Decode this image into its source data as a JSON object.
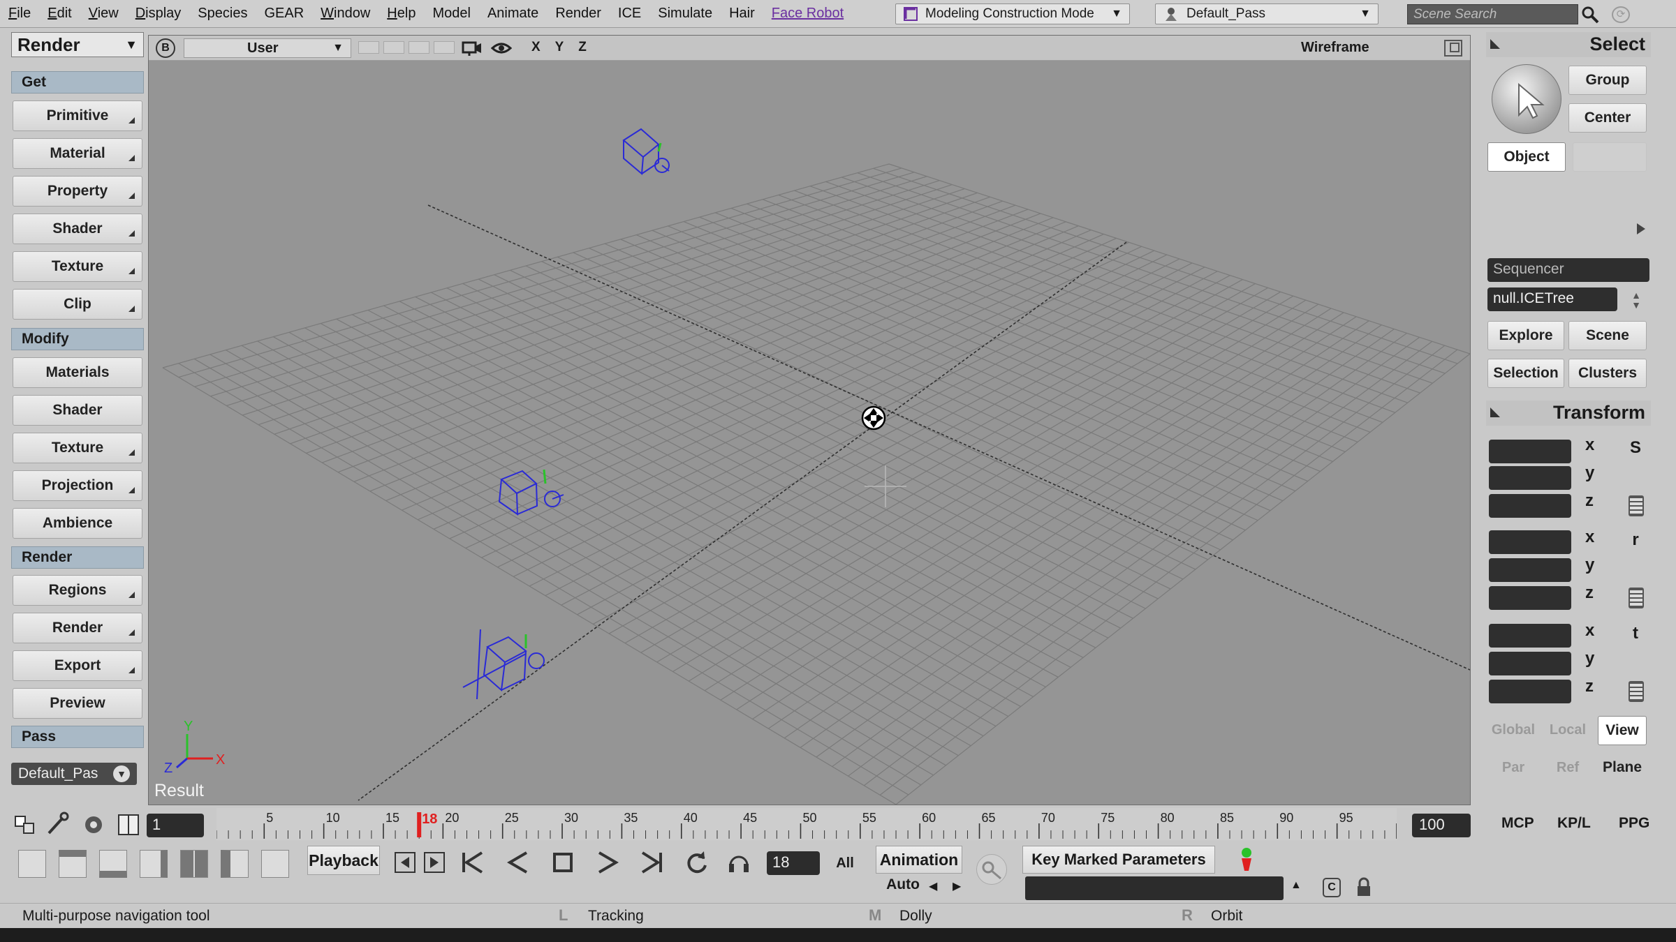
{
  "menubar": {
    "items": [
      "File",
      "Edit",
      "View",
      "Display",
      "Species",
      "GEAR",
      "Window",
      "Help",
      "Model",
      "Animate",
      "Render",
      "ICE",
      "Simulate",
      "Hair",
      "Face Robot"
    ],
    "construction_mode": "Modeling Construction Mode",
    "render_pass": "Default_Pass",
    "search_placeholder": "Scene Search"
  },
  "left_panel": {
    "module": "Render",
    "sections": {
      "get": "Get",
      "modify": "Modify",
      "render": "Render",
      "pass": "Pass"
    },
    "get_buttons": [
      "Primitive",
      "Material",
      "Property",
      "Shader",
      "Texture",
      "Clip"
    ],
    "modify_buttons": [
      "Materials",
      "Shader",
      "Texture",
      "Projection",
      "Ambience"
    ],
    "render_buttons": [
      "Regions",
      "Render",
      "Export",
      "Preview"
    ],
    "pass_value": "Default_Pas"
  },
  "viewport": {
    "camera": "User",
    "axes_label": "X Y Z",
    "display_mode": "Wireframe",
    "result_label": "Result",
    "axis_x": "X",
    "axis_y": "Y",
    "axis_z": "Z"
  },
  "right_panel": {
    "select_title": "Select",
    "group": "Group",
    "center": "Center",
    "object": "Object",
    "sequencer_placeholder": "Sequencer",
    "ice_tree": "null.ICETree",
    "explore": "Explore",
    "scene": "Scene",
    "selection": "Selection",
    "clusters": "Clusters",
    "transform_title": "Transform",
    "axes": [
      "x",
      "y",
      "z"
    ],
    "scale_icon": "S",
    "rotate_icon": "r",
    "translate_icon": "t",
    "global": "Global",
    "local": "Local",
    "view": "View",
    "par": "Par",
    "ref": "Ref",
    "plane": "Plane"
  },
  "timeline": {
    "start": "1",
    "end": "100",
    "current_frame": "18",
    "ticks": [
      "5",
      "10",
      "15",
      "20",
      "25",
      "30",
      "35",
      "40",
      "45",
      "50",
      "55",
      "60",
      "65",
      "70",
      "75",
      "80",
      "85",
      "90",
      "95"
    ],
    "mcp": "MCP",
    "kpl": "KP/L",
    "ppg": "PPG"
  },
  "playback": {
    "label": "Playback",
    "current": "18",
    "all": "All",
    "animation": "Animation",
    "auto": "Auto",
    "key_marked": "Key Marked Parameters"
  },
  "status": {
    "message": "Multi-purpose navigation tool",
    "left_key": "L",
    "left_action": "Tracking",
    "middle_key": "M",
    "middle_action": "Dolly",
    "right_key": "R",
    "right_action": "Orbit"
  },
  "colors": {
    "accent_menu": "#6a2fa0",
    "section_header": "#a9b9c6",
    "viewport_bg": "#959595",
    "wireframe_blue": "#2a2ad6",
    "playhead_red": "#e02020"
  }
}
